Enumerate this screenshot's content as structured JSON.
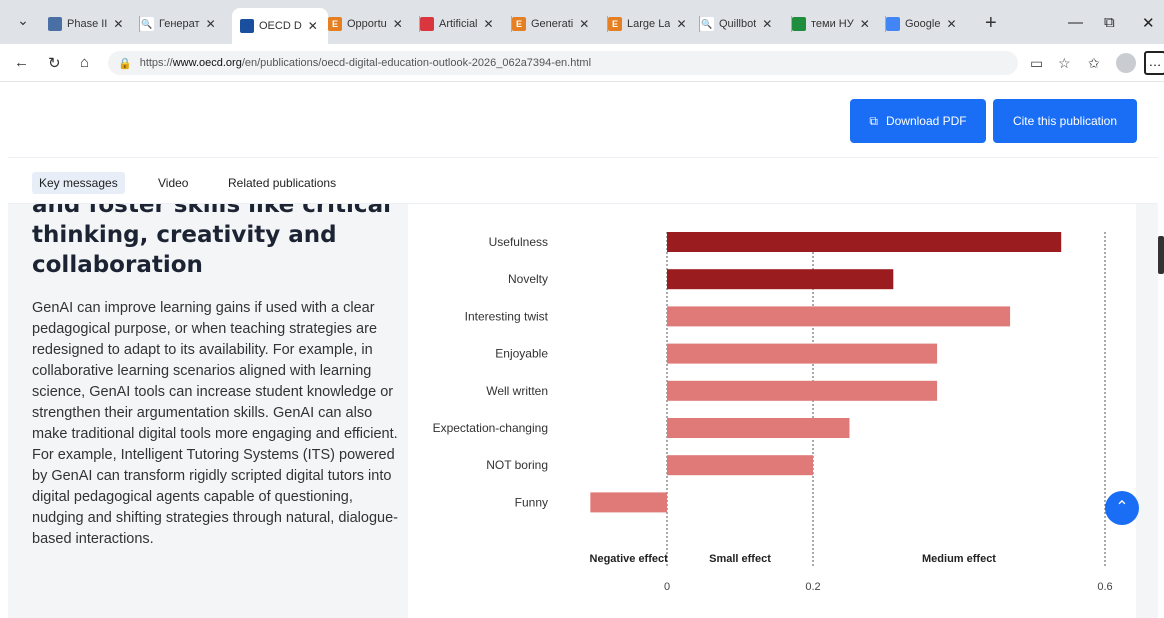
{
  "browser": {
    "tabs": [
      {
        "title": "Phase II",
        "favicon_color": "#4a6fa5",
        "favicon": ""
      },
      {
        "title": "Генерат",
        "favicon_color": "#ffffff",
        "favicon": "🔍"
      },
      {
        "title": "OECD D",
        "favicon_color": "#1a4fa0",
        "favicon": "",
        "active": true
      },
      {
        "title": "Opportu",
        "favicon_color": "#e67e22",
        "favicon": "E"
      },
      {
        "title": "Artificial",
        "favicon_color": "#d9363e",
        "favicon": ""
      },
      {
        "title": "Generati",
        "favicon_color": "#e67e22",
        "favicon": "E"
      },
      {
        "title": "Large La",
        "favicon_color": "#e67e22",
        "favicon": "E"
      },
      {
        "title": "Quillbot",
        "favicon_color": "#ffffff",
        "favicon": "🔍"
      },
      {
        "title": "теми НУ",
        "favicon_color": "#1e8e3e",
        "favicon": ""
      },
      {
        "title": "Google",
        "favicon_color": "#4285f4",
        "favicon": ""
      }
    ],
    "url": {
      "scheme": "https://",
      "host": "www.oecd.org",
      "path": "/en/publications/oecd-digital-education-outlook-2026_062a7394-en.html"
    }
  },
  "actions": {
    "download_pdf": "Download PDF",
    "cite": "Cite this publication"
  },
  "subnav": [
    "Key messages",
    "Video",
    "Related publications"
  ],
  "article": {
    "heading_lines": [
      "and foster skills like critical",
      "thinking, creativity and",
      "collaboration"
    ],
    "body": "GenAI can improve learning gains if used with a clear pedagogical purpose, or when teaching strategies are redesigned to adapt to its availability. For example, in collaborative learning scenarios aligned with learning science, GenAI tools can increase student knowledge or strengthen their argumentation skills. GenAI can also make traditional digital tools more engaging and efficient. For example, Intelligent Tutoring Systems (ITS) powered by GenAI can transform rigidly scripted digital tutors into digital pedagogical agents capable of questioning, nudging and shifting strategies through natural, dialogue-based interactions."
  },
  "chart_data": {
    "type": "bar",
    "orientation": "horizontal",
    "categories": [
      "Usefulness",
      "Novelty",
      "Interesting twist",
      "Enjoyable",
      "Well written",
      "Expectation-changing",
      "NOT boring",
      "Funny"
    ],
    "values": [
      0.54,
      0.31,
      0.47,
      0.37,
      0.37,
      0.25,
      0.2,
      -0.105
    ],
    "bar_colors": [
      "#9b1c1f",
      "#9b1c1f",
      "#e07a78",
      "#e07a78",
      "#e07a78",
      "#e07a78",
      "#e07a78",
      "#e07a78"
    ],
    "xlim": [
      -0.105,
      0.6
    ],
    "xticks": [
      "0",
      "0.2",
      "0.6"
    ],
    "tick_values": [
      0,
      0.2,
      0.6
    ],
    "zone_labels": [
      "Negative effect",
      "Small effect",
      "Medium effect"
    ],
    "zone_boundaries": [
      0,
      0.2,
      0.6
    ]
  }
}
